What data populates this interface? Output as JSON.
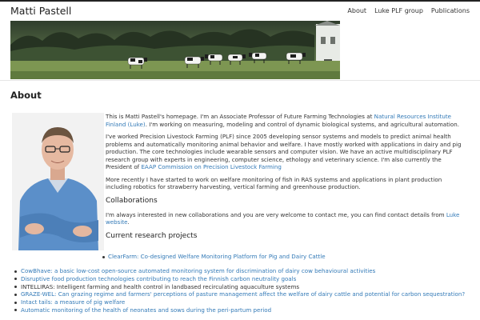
{
  "site": {
    "brand": "Matti Pastell",
    "nav": [
      "About",
      "Luke PLF group",
      "Publications"
    ]
  },
  "banner": {
    "alt": "cows grazing in pasture"
  },
  "page": {
    "title": "About",
    "photo_alt": "portrait of Matti Pastell"
  },
  "intro": {
    "p1_before": "This is Matti Pastell's homepage. I'm an Associate Professor of Future Farming Technologies at ",
    "p1_link": "Natural Resources Institute Finland (Luke)",
    "p1_after": ". I'm working on measuring, modeling and control of dynamic biological systems, and agricultural automation.",
    "p2_before": "I've worked Precision Livestock Farming (PLF) since 2005 developing sensor systems and models to predict animal health problems and automatically monitoring animal behavior and welfare. I have mostly worked with applications in dairy and pig production. The core technologies include wearable sensors and computer vision. We have an active multidisciplinary PLF research group with experts in engineering, computer science, ethology and veterinary science. I'm also currently the President of ",
    "p2_link": "EAAP Commission on Precision Livestock Farming",
    "p2_after": "",
    "p3": "More recently I have started to work on welfare monitoring of fish in RAS systems and applications in plant production including robotics for strawberry harvesting, vertical farming and greenhouse production."
  },
  "collab": {
    "heading": "Collaborations",
    "text_before": "I'm always interested in new collaborations and you are very welcome to contact me, you can find contact details from ",
    "link": "Luke website",
    "text_after": "."
  },
  "research": {
    "heading": "Current research projects",
    "first": "ClearFarm: Co-designed Welfare Monitoring Platform for Pig and Dairy Cattle",
    "items": [
      {
        "text": "CowBhave: a basic low-cost open-source automated monitoring system for discrimination of dairy cow behavioural activities",
        "link": true
      },
      {
        "text": "Disruptive food production technologies contributing to reach the Finnish carbon neutrality goals",
        "link": true
      },
      {
        "text": "INTELLIRAS: Intelligent farming and health control in landbased recirculating aquaculture systems",
        "link": false
      },
      {
        "text": "GRAZE-WEL: Can grazing regime and farmers' perceptions of pasture management affect the welfare of dairy cattle and potential for carbon sequestration?",
        "link": true
      },
      {
        "text": "Intact tails: a measure of pig welfare",
        "link": true
      },
      {
        "text": "Automatic monitoring of the health of neonates and sows during the peri-partum period",
        "link": true
      }
    ]
  },
  "colors": {
    "link": "#337ab7",
    "text": "#333333"
  }
}
